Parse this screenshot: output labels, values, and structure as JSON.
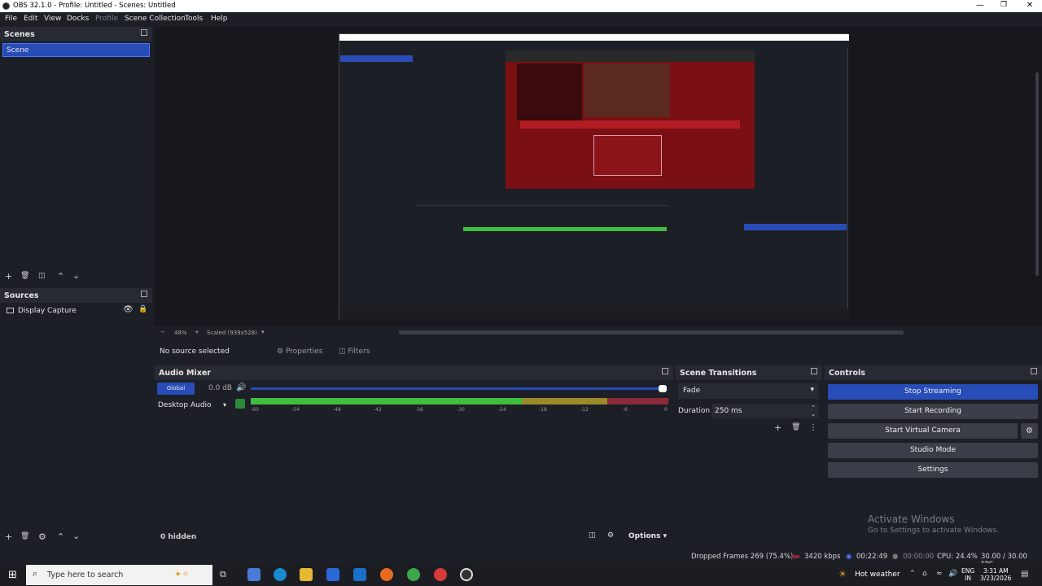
{
  "window": {
    "title": "OBS 32.1.0 - Profile: Untitled - Scenes: Untitled"
  },
  "menu": [
    "File",
    "Edit",
    "View",
    "Docks",
    "Profile",
    "Scene Collection",
    "Tools",
    "Help"
  ],
  "scenes": {
    "header": "Scenes",
    "items": [
      "Scene"
    ]
  },
  "sources": {
    "header": "Sources",
    "items": [
      {
        "label": "Display Capture"
      }
    ]
  },
  "preview": {
    "zoom": "48%",
    "scaled_label": "Scaled (939x528)"
  },
  "context_bar": {
    "no_source": "No source selected",
    "properties": "Properties",
    "filters": "Filters"
  },
  "audio_mixer": {
    "header": "Audio Mixer",
    "global_label": "Global",
    "global_db": "0.0 dB",
    "desktop_label": "Desktop Audio",
    "scale": [
      "-60",
      "-54",
      "-48",
      "-42",
      "-36",
      "-30",
      "-24",
      "-18",
      "-12",
      "-6",
      "0"
    ],
    "hidden": "0 hidden",
    "options": "Options"
  },
  "transitions": {
    "header": "Scene Transitions",
    "selected": "Fade",
    "duration_label": "Duration",
    "duration_value": "250 ms"
  },
  "controls": {
    "header": "Controls",
    "stop_streaming": "Stop Streaming",
    "start_recording": "Start Recording",
    "start_virtual_camera": "Start Virtual Camera",
    "studio_mode": "Studio Mode",
    "settings": "Settings"
  },
  "watermark": {
    "title": "Activate Windows",
    "subtitle": "Go to Settings to activate Windows."
  },
  "status": {
    "dropped_frames": "Dropped Frames 269 (75.4%)",
    "bitrate": "3420 kbps",
    "stream_time": "00:22:49",
    "rec_time": "00:00:00",
    "cpu": "CPU: 24.4%",
    "fps": "30.00 / 30.00 FPS"
  },
  "taskbar": {
    "search_placeholder": "Type here to search",
    "weather": "Hot weather",
    "lang_top": "ENG",
    "lang_bottom": "IN",
    "time": "3:31 AM",
    "date": "3/23/2026"
  },
  "colors": {
    "accent": "#284cb8",
    "meter_green": "#3fbe3f",
    "meter_yellow": "#9a8a2a",
    "meter_red": "#8a2a3a"
  }
}
